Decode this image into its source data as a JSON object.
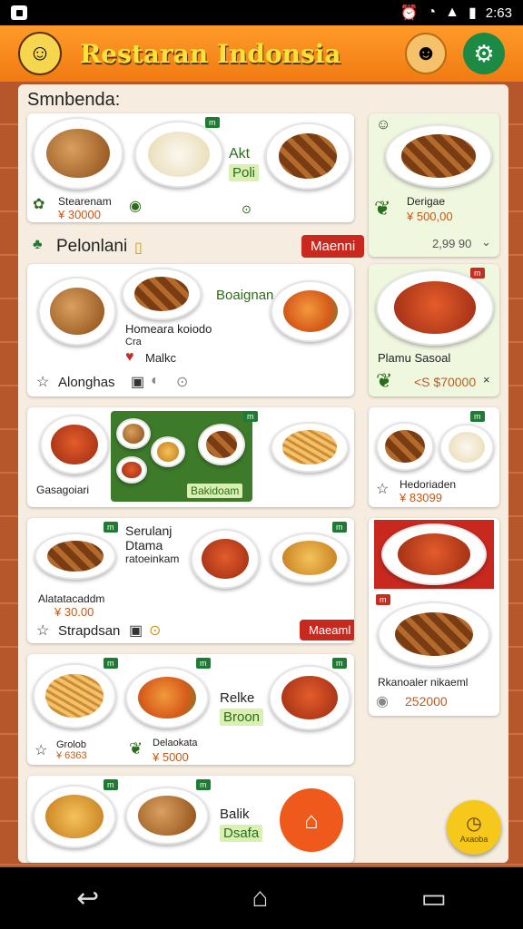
{
  "status": {
    "time": "2:63",
    "alarm_icon": "alarm-icon",
    "wifi_icon": "wifi-icon",
    "battery_icon": "battery-icon"
  },
  "app": {
    "title": "Restaran Indonsia",
    "avatar_icon": "chef-avatar-icon",
    "face_icon": "smiley-icon",
    "settings_icon": "gear-icon"
  },
  "sections": {
    "featured": "Smnbenda:",
    "popular": "Pelonlani",
    "popular_button": "Maenni"
  },
  "cards": {
    "c1": {
      "name": "Stearenam",
      "price": "¥ 30000",
      "side1": "Akt",
      "side2": "Poli",
      "tag": "m"
    },
    "c2": {
      "name": "Derigae",
      "price": "¥ 500,00",
      "footer": "2,99 90"
    },
    "c3": {
      "title": "Boaignan",
      "sub1": "Homeara koiodo",
      "sub2": "Cra",
      "sub3": "Malkc",
      "footer": "Alonghas"
    },
    "c4": {
      "name": "Plamu Sasoal",
      "price": "<S $70000"
    },
    "c5": {
      "name": "Gasagoiari",
      "label": "Bakidoam"
    },
    "c6": {
      "name": "Hedoriaden",
      "price": "¥ 83099"
    },
    "c7": {
      "title1": "Serulanj",
      "title2": "Dtama",
      "title3": "ratoeinkam",
      "name": "Alatatacaddm",
      "price": "¥ 30.00",
      "footer": "Strapdsan",
      "button": "Maeaml"
    },
    "c8": {
      "name": "Rkanoaler nikaeml",
      "price": "252000"
    },
    "c9": {
      "name1": "Grolob",
      "price1": "¥ 6363",
      "title": "Relke",
      "label": "Broon",
      "name2": "Delaokata",
      "price2": "¥ 5000"
    },
    "c10": {
      "title": "Balik",
      "label": "Dsafa"
    }
  },
  "fab": {
    "label": "Axaoba",
    "icon": "clock-icon"
  },
  "nav": {
    "back_icon": "back-icon",
    "home_icon": "home-icon",
    "recents_icon": "recents-icon"
  },
  "colors": {
    "appbar": "#f07b12",
    "accent_green": "#1c8a45",
    "accent_red": "#c9281e",
    "price": "#c25a1a"
  }
}
